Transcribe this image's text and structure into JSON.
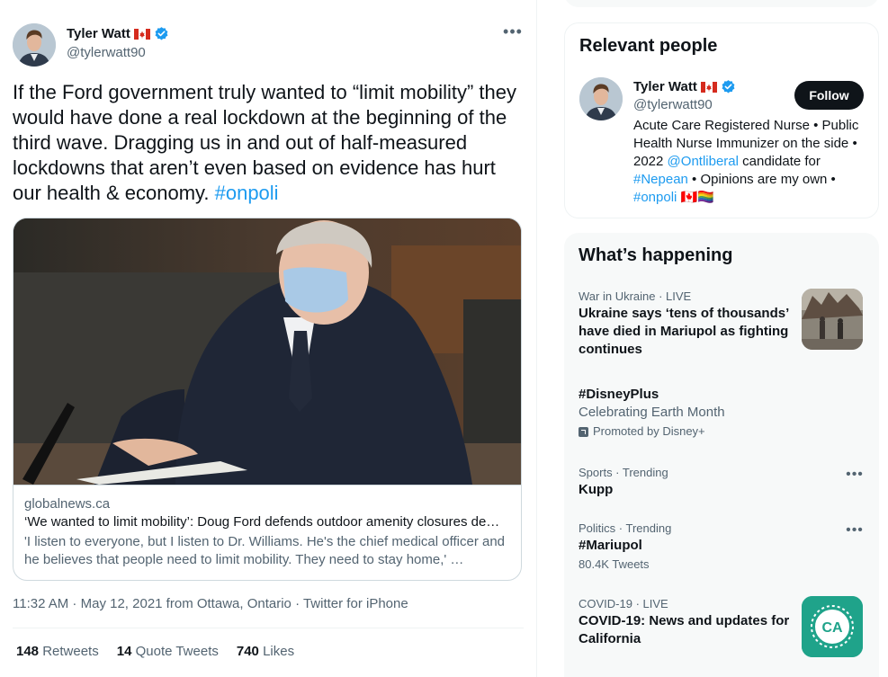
{
  "tweet": {
    "author_name": "Tyler Watt",
    "author_handle": "@tylerwatt90",
    "more_icon": "•••",
    "text_main": "If the Ford government truly wanted to “limit mobility” they would have done a real lockdown at the beginning of the third wave. Dragging us in and out of half-measured lockdowns that aren’t even based on evidence has hurt our health & economy. ",
    "text_hashtag": "#onpoli",
    "card": {
      "domain": "globalnews.ca",
      "title": "‘We wanted to limit mobility’: Doug Ford defends outdoor amenity closures de…",
      "description": "'I listen to everyone, but I listen to Dr. Williams. He's the chief medical officer and he believes that people need to limit mobility. They need to stay home,' …"
    },
    "time": "11:32 AM",
    "dot": " · ",
    "date": "May 12, 2021",
    "location": " from Ottawa, Ontario",
    "client": "Twitter for iPhone",
    "stats": {
      "retweets_count": "148",
      "retweets_label": " Retweets",
      "quotes_count": "14",
      "quotes_label": " Quote Tweets",
      "likes_count": "740",
      "likes_label": " Likes"
    }
  },
  "relevant_people": {
    "title": "Relevant people",
    "name": "Tyler Watt",
    "handle": "@tylerwatt90",
    "follow_label": "Follow",
    "bio_1": "Acute Care Registered Nurse • Public Health Nurse Immunizer on the side • 2022 ",
    "bio_mention": "@Ontliberal",
    "bio_2": " candidate for ",
    "bio_hashtag1": "#Nepean",
    "bio_3": " • Opinions are my own • ",
    "bio_hashtag2": "#onpoli",
    "bio_emoji": "🇨🇦🏳️‍🌈"
  },
  "whats_happening": {
    "title": "What’s happening",
    "trends": [
      {
        "category": "War in Ukraine · LIVE",
        "title": "Ukraine says ‘tens of thousands’ have died in Mariupol as fighting continues"
      },
      {
        "category": "",
        "title": "#DisneyPlus",
        "subtitle": "Celebrating Earth Month",
        "promo": "Promoted by Disney+"
      },
      {
        "category": "Sports · Trending",
        "title": "Kupp"
      },
      {
        "category": "Politics · Trending",
        "title": "#Mariupol",
        "count": "80.4K Tweets"
      },
      {
        "category": "COVID-19 · LIVE",
        "title": "COVID-19: News and updates for California",
        "badge": "CA"
      }
    ]
  },
  "colors": {
    "accent": "#1d9bf0",
    "text": "#0f1419",
    "muted": "#536471",
    "follow_bg": "#0f1419",
    "covid_badge": "#1fa38a"
  },
  "icons": {
    "verified": "verified-badge-icon",
    "flag": "canada-flag-icon",
    "more": "more-dots-icon",
    "promoted": "promoted-arrow-icon"
  }
}
